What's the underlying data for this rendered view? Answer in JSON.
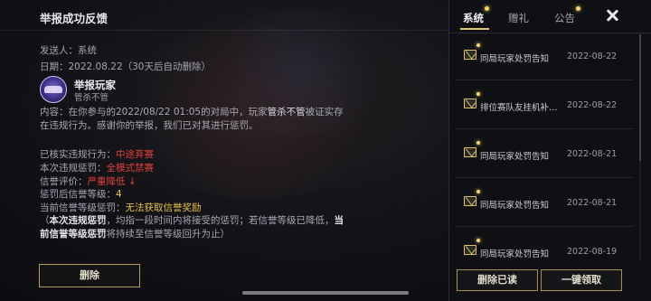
{
  "detail": {
    "title": "举报成功反馈",
    "sender_label": "发送人：",
    "sender": "系统",
    "date_label": "日期：",
    "date": "2022.08.22（30天后自动删除）",
    "reporter_title": "举报玩家",
    "reporter_name": "管杀不管",
    "content_prefix": "内容：在你参与的2022/08/22 01:05的对局中，玩家",
    "content_player": "管杀不管",
    "content_suffix": "被证实存在违规行为。感谢你的举报，我们已对其进行惩罚。",
    "rows": [
      {
        "label": "已核实违规行为：",
        "value": "中途弃赛",
        "color": "#e0413a"
      },
      {
        "label": "本次违规惩罚：",
        "value": "全模式禁赛",
        "color": "#e0413a"
      },
      {
        "label": "信誉评价：",
        "value": "严重降低 ↓",
        "color": "#e0413a"
      },
      {
        "label": "惩罚后信誉等级：",
        "value": "4",
        "color": "#e8c244"
      },
      {
        "label": "当前信誉等级惩罚：",
        "value": "无法获取信誉奖励",
        "color": "#e8c244"
      }
    ],
    "notice_part1": "（",
    "notice_bold1": "本次违规惩罚",
    "notice_part2": "，均指一段时间内将接受的惩罚；若信誉等级已降低，",
    "notice_bold2": "当前信誉等级惩罚",
    "notice_part3": "将持续至信誉等级回升为止）",
    "delete_button": "删除"
  },
  "mailbox": {
    "tabs": [
      {
        "label": "系统",
        "active": true
      },
      {
        "label": "赠礼",
        "active": false
      },
      {
        "label": "公告",
        "active": false
      }
    ],
    "close_icon": "close-icon",
    "items": [
      {
        "title": "同局玩家处罚告知",
        "date": "2022-08-22",
        "unread": true
      },
      {
        "title": "排位赛队友挂机补偿...",
        "date": "2022-08-22",
        "unread": true
      },
      {
        "title": "同局玩家处罚告知",
        "date": "2022-08-21",
        "unread": true
      },
      {
        "title": "同局玩家处罚告知",
        "date": "2022-08-21",
        "unread": true
      },
      {
        "title": "同局玩家处罚告知",
        "date": "2022-08-19",
        "unread": true
      }
    ],
    "read_delete_button": "删除已读",
    "claim_all_button": "一键领取"
  },
  "colors": {
    "accent_gold": "#e5c567",
    "penalty_red": "#e0413a",
    "level_yellow": "#e8c244"
  }
}
